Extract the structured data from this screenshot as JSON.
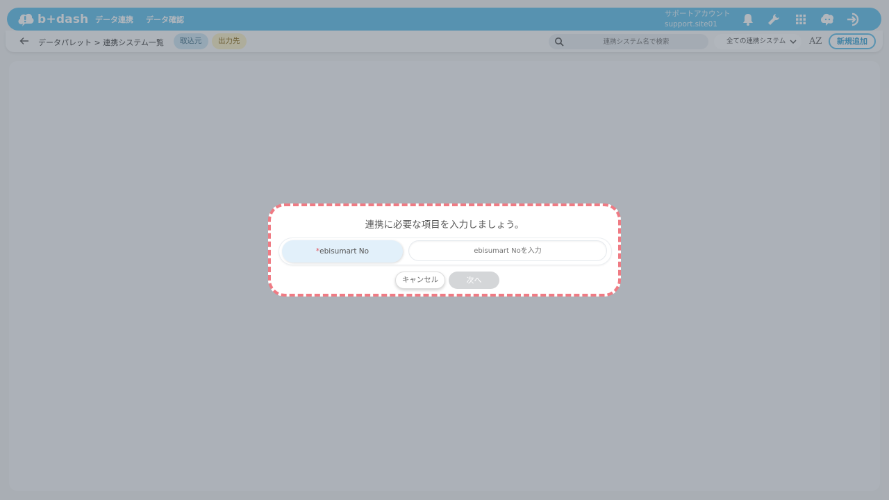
{
  "header": {
    "logo_text": "b+dash",
    "nav": [
      "データ連携",
      "データ確認"
    ],
    "account_name": "サポートアカウント",
    "account_id": "support.site01",
    "icons": [
      "bell-icon",
      "wrench-icon",
      "apps-grid-icon",
      "chat-bot-icon",
      "logout-icon"
    ],
    "accent_color": "#64c1ea"
  },
  "subbar": {
    "breadcrumb": "データパレット > 連携システム一覧",
    "tab_import": "取込元",
    "tab_export": "出力先",
    "search_placeholder": "連携システム名で検索",
    "filter_value": "全ての連携システム",
    "sort_label": "AZ",
    "new_button": "新規追加"
  },
  "modal": {
    "title": "連携に必要な項目を入力しましょう。",
    "required_mark": "*",
    "field_label": "ebisumart No",
    "field_placeholder": "ebisumart Noを入力",
    "field_value": "",
    "cancel_label": "キャンセル",
    "next_label": "次へ",
    "highlight_color": "#ef7b84"
  }
}
